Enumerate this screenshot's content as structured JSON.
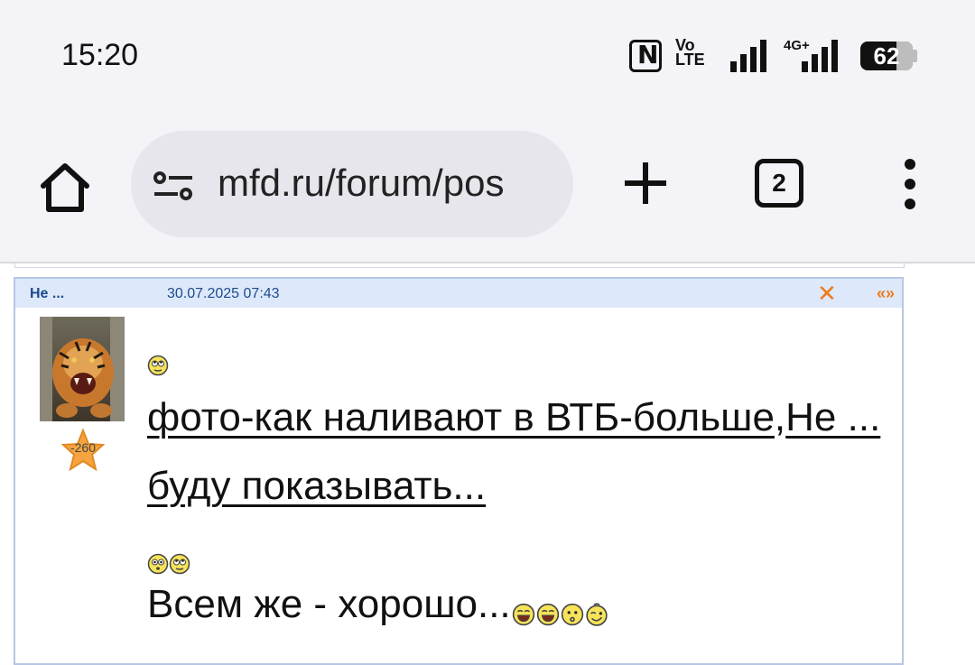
{
  "status_bar": {
    "time": "15:20",
    "volte_top": "Vo",
    "volte_bottom": "LTE",
    "network": "4G+",
    "battery": "62"
  },
  "browser": {
    "url": "mfd.ru/forum/pos",
    "tab_count": "2",
    "icons": [
      "home-icon",
      "site-settings-icon",
      "plus-icon",
      "tabs-icon",
      "more-menu-icon"
    ]
  },
  "post": {
    "author": "Не ...",
    "date": "30.07.2025 07:43",
    "close_symbol": "✕",
    "quote_symbol": "«»",
    "rating": "-260",
    "link_part1": "фото-как наливают в ВТБ-больше",
    "link_sep": ",",
    "link_part2": "Не ... буду показывать...",
    "text": "Всем же - хорошо...",
    "colors": {
      "header_bg": "#dde9fb",
      "header_text": "#1e4a8c",
      "accent": "#f07a1a"
    }
  }
}
